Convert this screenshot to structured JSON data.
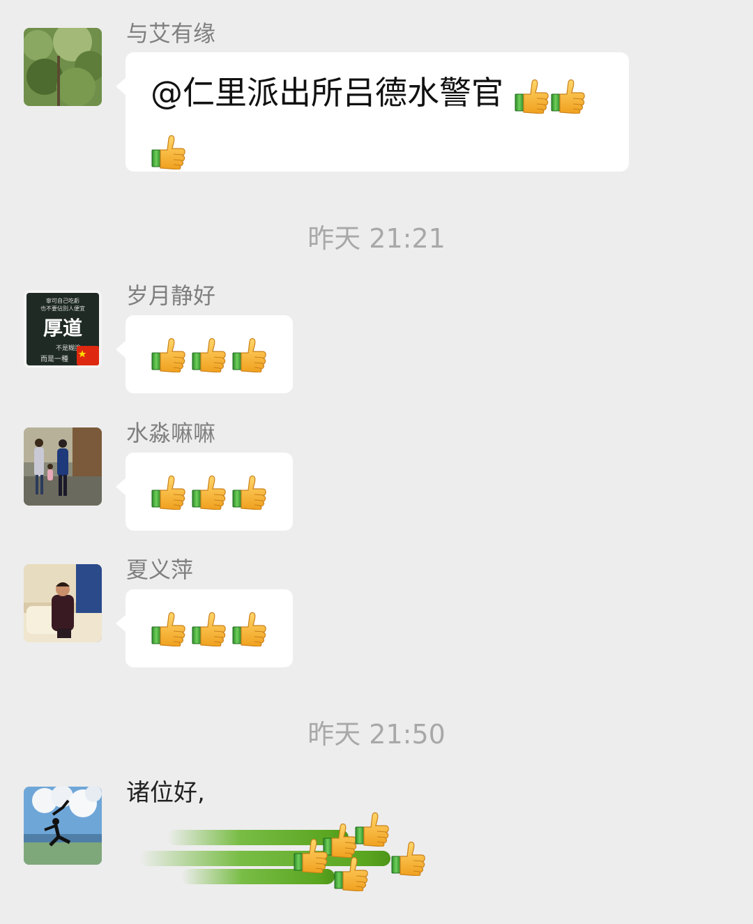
{
  "messages": [
    {
      "sender": "与艾有缘",
      "text": "@仁里派出所吕德水警官",
      "emoji": [
        "thumbs-up",
        "thumbs-up",
        "thumbs-up"
      ]
    },
    {
      "sender": "岁月静好",
      "emoji": [
        "thumbs-up",
        "thumbs-up",
        "thumbs-up"
      ],
      "avatar_text": {
        "line1": "寧可自己吃虧",
        "line2": "也不要佔別人便宜",
        "title": "厚道",
        "line3": "不是糊塗",
        "line4": "而是一種"
      }
    },
    {
      "sender": "水淼嘛嘛",
      "emoji": [
        "thumbs-up",
        "thumbs-up",
        "thumbs-up"
      ]
    },
    {
      "sender": "夏义萍",
      "emoji": [
        "thumbs-up",
        "thumbs-up",
        "thumbs-up"
      ]
    },
    {
      "sender": "",
      "text": "诸位好,",
      "sticker": "flying-thumbs-up"
    }
  ],
  "timestamps": [
    "昨天 21:21",
    "昨天 21:50"
  ],
  "colors": {
    "background": "#ededed",
    "bubble": "#ffffff",
    "name": "#7f7f7f",
    "timestamp": "#a8a8a8",
    "thumb": "#f5b52e",
    "cuff": "#3fa83a"
  }
}
